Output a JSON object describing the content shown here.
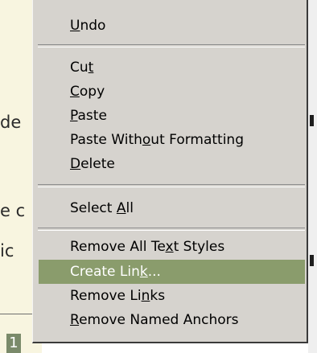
{
  "document": {
    "fragments": [
      "de",
      "e c",
      "ic",
      "1"
    ]
  },
  "menu": {
    "items": [
      {
        "label": "Undo"
      },
      {
        "label": "Cut"
      },
      {
        "label": "Copy"
      },
      {
        "label": "Paste"
      },
      {
        "label": "Paste Without Formatting"
      },
      {
        "label": "Delete"
      },
      {
        "label": "Select All"
      },
      {
        "label": "Remove All Text Styles"
      },
      {
        "label": "Create Link..."
      },
      {
        "label": "Remove Links"
      },
      {
        "label": "Remove Named Anchors"
      }
    ]
  },
  "colors": {
    "menu_background": "#d6d3ce",
    "highlight": "#8a9c6c",
    "doc_background": "#f8f5e0"
  }
}
